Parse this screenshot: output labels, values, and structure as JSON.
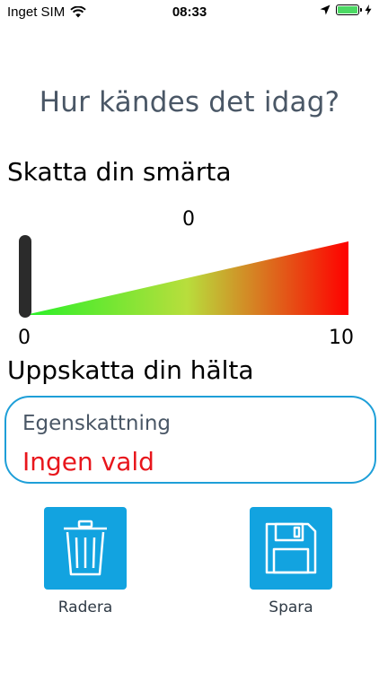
{
  "status_bar": {
    "carrier": "Inget SIM",
    "time": "08:33",
    "battery_color": "#4cd964"
  },
  "page": {
    "title": "Hur kändes det idag?"
  },
  "pain": {
    "title": "Skatta din smärta",
    "slider": {
      "value": "0",
      "min_label": "0",
      "max_label": "10",
      "value_number": 0,
      "min": 0,
      "max": 10,
      "gradient_colors": [
        "#28f028",
        "#b8de3c",
        "#ff0000"
      ]
    }
  },
  "limp": {
    "title": "Uppskatta din hälta",
    "field_label": "Egenskattning",
    "field_value": "Ingen vald",
    "value_color": "#e8161c",
    "border_color": "#1e9fd8"
  },
  "actions": {
    "delete_label": "Radera",
    "save_label": "Spara",
    "tile_color": "#12a3e0",
    "delete_icon": "trash-icon",
    "save_icon": "floppy-disk-icon"
  }
}
